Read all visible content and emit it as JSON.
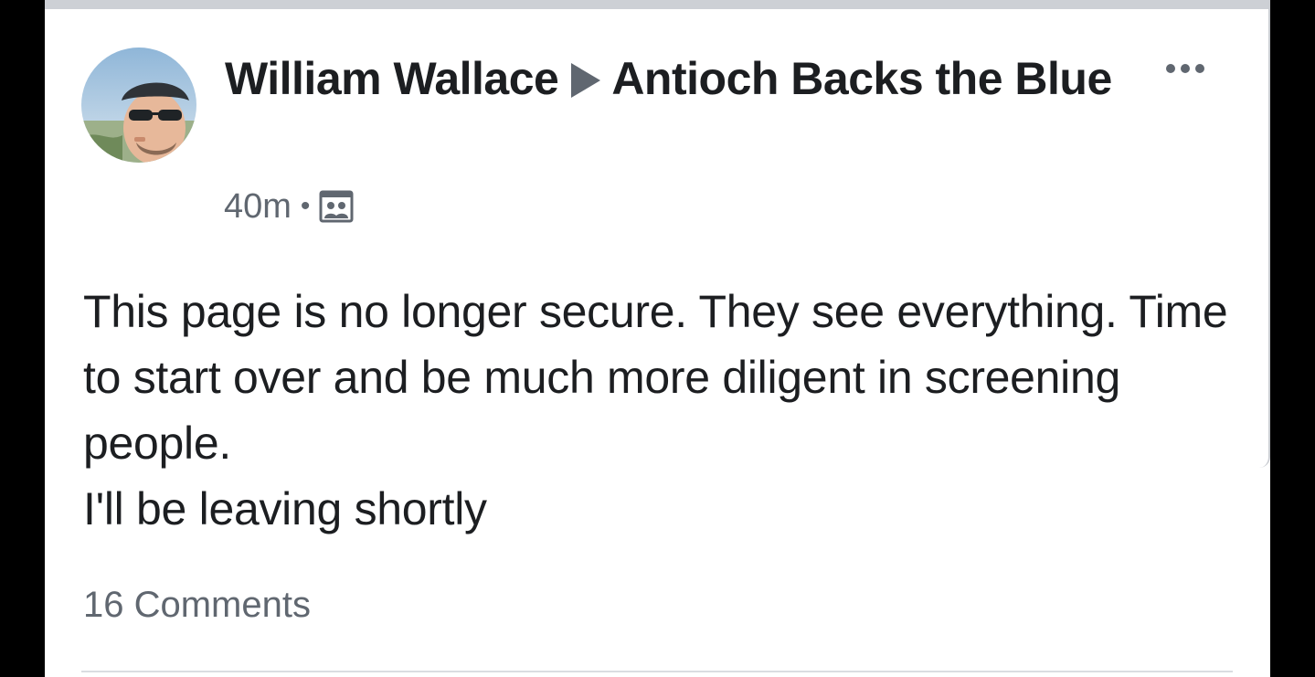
{
  "post": {
    "author_name": "William Wallace",
    "group_name": "Antioch Backs the Blue",
    "timestamp": "40m",
    "separator": "•",
    "audience_icon": "group-audience-icon",
    "body_paragraphs": [
      "This page is no longer secure. They see everything. Time to start over and be much more diligent in screening people.",
      "I'll be leaving shortly"
    ],
    "comments_label": "16 Comments"
  },
  "colors": {
    "primary_text": "#1c1e21",
    "secondary_text": "#606770",
    "divider": "#cdd0d5",
    "background_frame": "#000000",
    "card": "#ffffff"
  }
}
